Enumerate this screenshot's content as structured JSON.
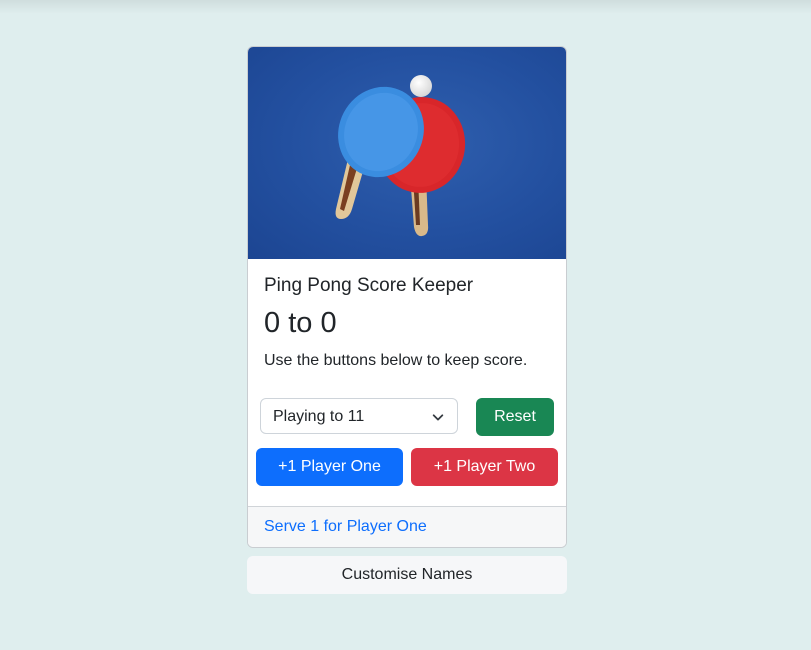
{
  "card": {
    "image_alt": "ping-pong-paddles-photo",
    "title": "Ping Pong Score Keeper",
    "score": {
      "player_one": "0",
      "separator": "to",
      "player_two": "0"
    },
    "description": "Use the buttons below to keep score.",
    "select": {
      "selected": "Playing to 11",
      "options": [
        "Playing to 11"
      ]
    },
    "reset_label": "Reset",
    "player_one_button": "+1 Player One",
    "player_two_button": "+1 Player Two",
    "footer_link": "Serve 1 for Player One"
  },
  "customise_names_label": "Customise Names",
  "colors": {
    "page_bg": "#dfeeee",
    "primary": "#0d6efd",
    "success": "#198754",
    "danger": "#dc3545"
  }
}
